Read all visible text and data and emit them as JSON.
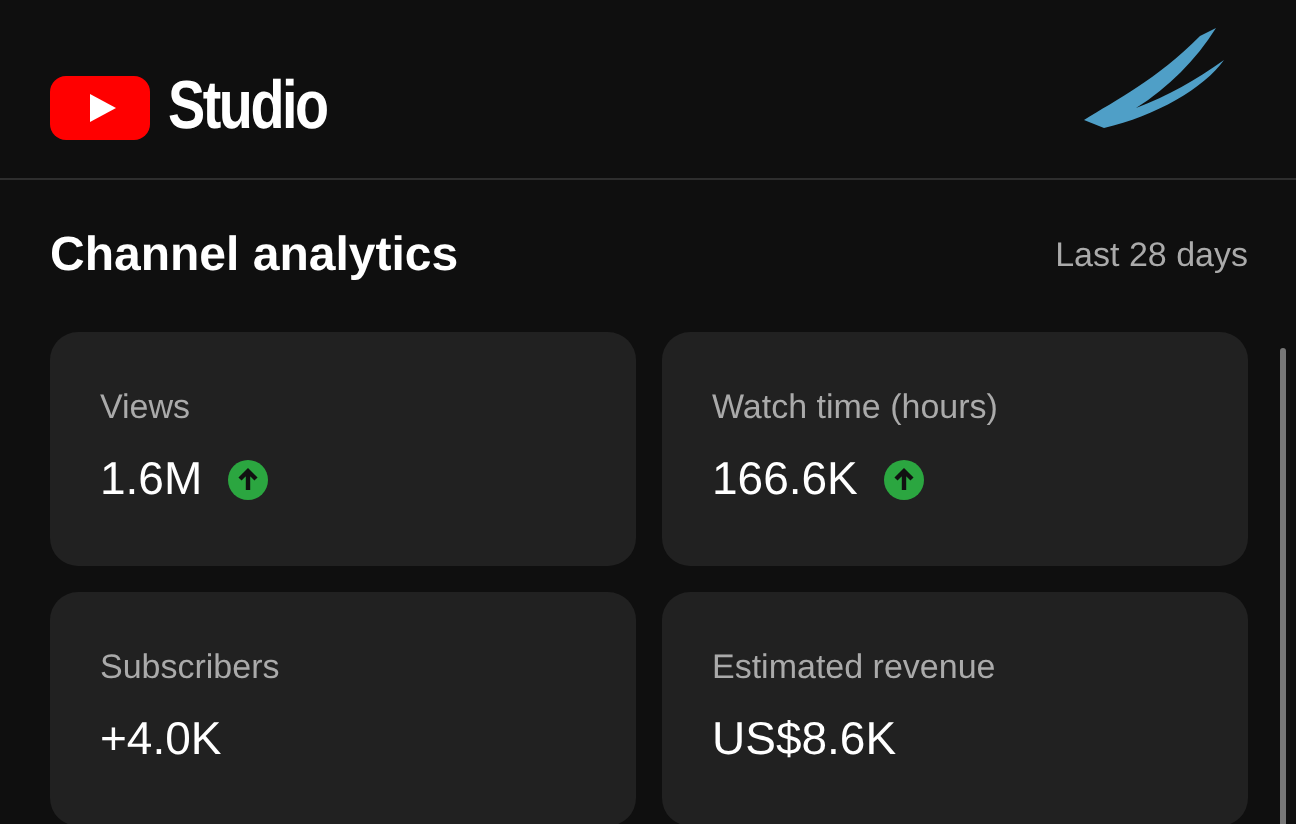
{
  "header": {
    "app_name": "Studio"
  },
  "section": {
    "title": "Channel analytics",
    "period": "Last 28 days"
  },
  "metrics": [
    {
      "label": "Views",
      "value": "1.6M",
      "rising": true
    },
    {
      "label": "Watch time (hours)",
      "value": "166.6K",
      "rising": true
    },
    {
      "label": "Subscribers",
      "value": "+4.0K",
      "rising": false
    },
    {
      "label": "Estimated revenue",
      "value": "US$8.6K",
      "rising": false
    }
  ]
}
